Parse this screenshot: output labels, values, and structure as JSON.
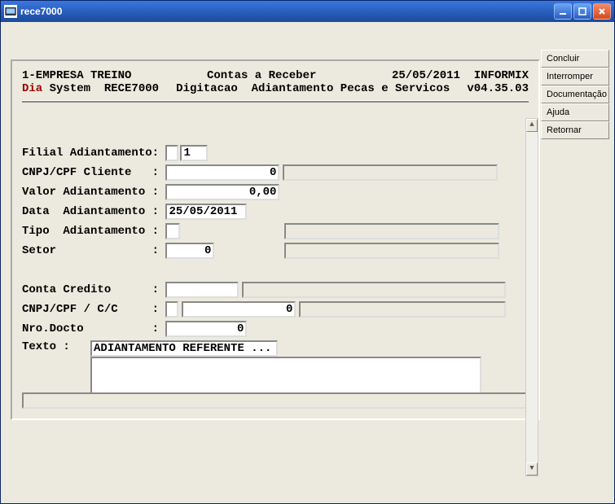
{
  "window": {
    "title": "rece7000"
  },
  "sidebar": {
    "buttons": [
      "Concluir",
      "Interromper",
      "Documentação",
      "Ajuda",
      "Retornar"
    ]
  },
  "header": {
    "company": "1-EMPRESA TREINO",
    "module": "Contas a Receber",
    "date": "25/05/2011",
    "db": "INFORMIX",
    "dia": "Dia",
    "system": " System  RECE7000",
    "screen": "Digitacao  Adiantamento Pecas e Servicos",
    "version": "v04.35.03"
  },
  "form": {
    "labels": {
      "filial": "Filial Adiantamento: ",
      "cnpj_cliente": "CNPJ/CPF Cliente   : ",
      "valor": "Valor Adiantamento : ",
      "data": "Data  Adiantamento : ",
      "tipo": "Tipo  Adiantamento : ",
      "setor": "Setor              : ",
      "conta_credito": "Conta Credito      : ",
      "cnpj_cc": "CNPJ/CPF / C/C     : ",
      "nro_docto": "Nro.Docto          : ",
      "texto": "Texto :   "
    },
    "values": {
      "filial_small": "",
      "filial": "1",
      "cnpj_cliente": "0",
      "cnpj_cliente_desc": "",
      "valor": "0,00",
      "data": "25/05/2011",
      "tipo": "",
      "tipo_desc": "",
      "setor": "0",
      "setor_desc": "",
      "conta_credito": "",
      "conta_credito_desc": "",
      "cnpj_cc_small": "",
      "cnpj_cc": "0",
      "cnpj_cc_desc": "",
      "nro_docto": "0",
      "texto": "ADIANTAMENTO REFERENTE ..."
    }
  }
}
